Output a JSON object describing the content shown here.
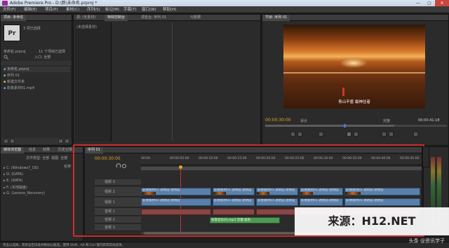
{
  "window": {
    "title": "Adobe Premiere Pro - D:\\新\\未命名.prproj *",
    "min": "—",
    "max": "▢",
    "close": "✕"
  },
  "menu": [
    "文件(F)",
    "编辑(E)",
    "项目(P)",
    "素材(C)",
    "序列(S)",
    "标记(M)",
    "字幕(T)",
    "窗口(W)",
    "帮助(H)"
  ],
  "project_panel": {
    "tabs": [
      "项目: 未命名",
      "源: (无素材)",
      "特效控制台",
      "调音台: 序列 01",
      "元数据"
    ],
    "thumb_label": "Pr",
    "info_line1": "3 项已选择",
    "name_label": "未命名.prproj",
    "count_label": "11 个项目已选择",
    "search_label": "入口: 全部",
    "items": [
      "未命名.prproj",
      "序列 01",
      "新建文件夹",
      "影像素材01.mp4"
    ],
    "effect_title": "(未选择素材)"
  },
  "program_monitor": {
    "tab": "节目: 序列 01",
    "subtitle": "青山不墨 最神往者",
    "timecode_left": "00:00:30:00",
    "fit": "适合",
    "quality": "完整",
    "timecode_right": "00:00:41:18"
  },
  "media_browser": {
    "tabs": [
      "媒体浏览器",
      "信息",
      "效果",
      "历史记录"
    ],
    "drives": [
      "C: (Windows7_OS)",
      "D: (DATA)",
      "E: (DATA)",
      "F: (本地磁盘)",
      "G: (Lenovo_Recovery)"
    ],
    "filter_label": "文件类型: 全部",
    "view_label": "视图: 全部",
    "col_name": "名称"
  },
  "timeline": {
    "tab": "序列 01",
    "timecode": "00:00:30:00",
    "ruler": [
      "00:00",
      "00:00:05:00",
      "00:00:10:00",
      "00:00:15:00",
      "00:00:20:00",
      "00:00:25:00",
      "00:00:30:00",
      "00:00:35:00",
      "00:00:40:00",
      "00:00:45:00"
    ],
    "tracks": [
      "视频 3",
      "视频 2",
      "视频 1",
      "音频 1",
      "音频 2",
      "音频 3"
    ],
    "clip_label": "影像素材01 透明度:透明度",
    "green_clip": "背景音乐01.mp3 音量:级别",
    "status": "单击以选择，或单击空白处并拖动以框选。使用 Shift、Alt 和 Ctrl 键可获得其他选项。"
  },
  "watermark": {
    "brand": "来源：H12.NET",
    "corner": "头条 @资讯学子"
  }
}
